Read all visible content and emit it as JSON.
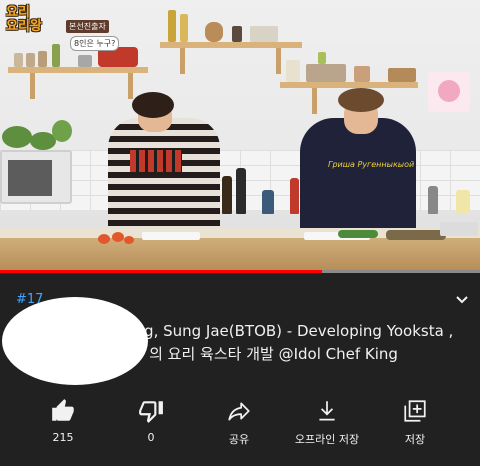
{
  "video": {
    "badge": {
      "line1": "요리",
      "line2": "요리왕",
      "sub1": "본선진출자",
      "sub2": "8인은 누구?"
    },
    "sweater_text": "Гриша Ругенныкыой",
    "progress_fraction": 0.67,
    "colors": {
      "progress": "#ff0000",
      "accent_link": "#3ea6ff"
    }
  },
  "info": {
    "hashtag": "#17",
    "title": "[TVPP] Eun Kwang, Sung Jae(BTOB) - Developing Yooksta , 성재, 은광(B1A4) – 의 요리 육스타 개발 @Idol Chef King",
    "expand_icon": "chevron-down-icon"
  },
  "actions": [
    {
      "name": "like-button",
      "icon": "thumbs-up-icon",
      "label": "215"
    },
    {
      "name": "dislike-button",
      "icon": "thumbs-down-icon",
      "label": "0"
    },
    {
      "name": "share-button",
      "icon": "share-arrow-icon",
      "label": "공유"
    },
    {
      "name": "download-button",
      "icon": "download-icon",
      "label": "오프라인 저장"
    },
    {
      "name": "save-button",
      "icon": "add-to-playlist-icon",
      "label": "저장"
    }
  ]
}
